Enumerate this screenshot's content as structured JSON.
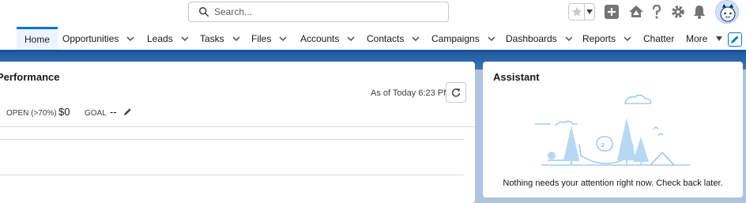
{
  "header": {
    "search": {
      "placeholder": "Search..."
    },
    "icons": [
      "star-icon",
      "add-icon",
      "trailhead-icon",
      "help-icon",
      "setup-icon",
      "bell-icon",
      "avatar"
    ]
  },
  "nav": {
    "items": [
      {
        "label": "Home",
        "active": true,
        "has_menu": false
      },
      {
        "label": "Opportunities",
        "has_menu": true
      },
      {
        "label": "Leads",
        "has_menu": true
      },
      {
        "label": "Tasks",
        "has_menu": true
      },
      {
        "label": "Files",
        "has_menu": true
      },
      {
        "label": "Accounts",
        "has_menu": true
      },
      {
        "label": "Contacts",
        "has_menu": true
      },
      {
        "label": "Campaigns",
        "has_menu": true
      },
      {
        "label": "Dashboards",
        "has_menu": true
      },
      {
        "label": "Reports",
        "has_menu": true
      },
      {
        "label": "Chatter",
        "has_menu": false
      },
      {
        "label": "More",
        "has_menu": true
      }
    ]
  },
  "performance": {
    "title": "Performance",
    "as_of": "As of Today 6:23 PM",
    "open_label": "OPEN (>70%)",
    "open_value": "$0",
    "goal_label": "GOAL",
    "goal_value": "--"
  },
  "assistant": {
    "title": "Assistant",
    "message": "Nothing needs your attention right now. Check back later."
  },
  "colors": {
    "brand_blue": "#0176d3",
    "nav_band": "#1b5297",
    "illustration_blue": "#8fc2ea"
  }
}
